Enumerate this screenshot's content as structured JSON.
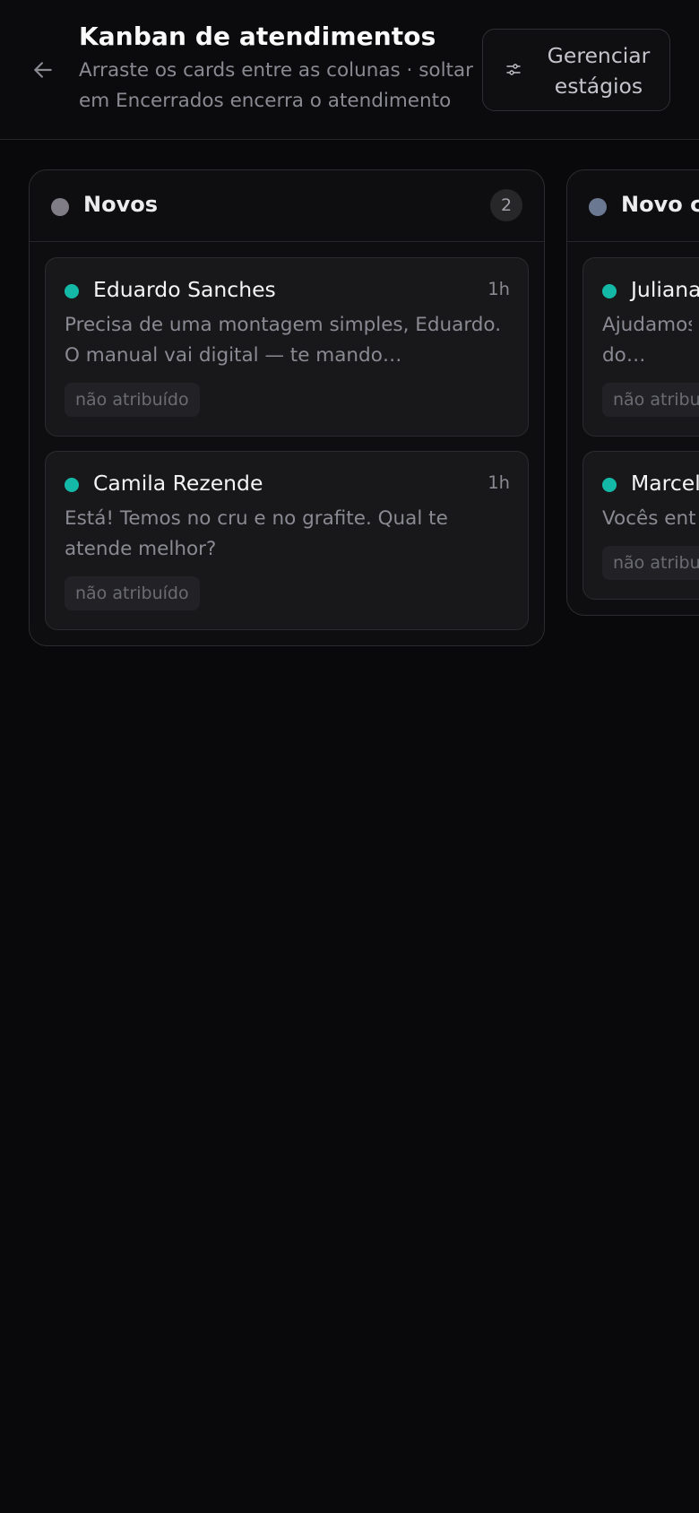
{
  "header": {
    "title": "Kanban de atendimentos",
    "subtitle": "Arraste os cards entre as colunas · soltar em Encerrados encerra o atendimento",
    "manage_button": "Gerenciar estágios"
  },
  "columns": [
    {
      "title": "Novos",
      "count": "2",
      "dot_color": "#807d87",
      "cards": [
        {
          "name": "Eduardo Sanches",
          "time": "1h",
          "preview": "Precisa de uma montagem simples, Eduardo. O manual vai digital — te mando…",
          "assignee": "não atribuído"
        },
        {
          "name": "Camila Rezende",
          "time": "1h",
          "preview": "Está! Temos no cru e no grafite. Qual te atende melhor?",
          "assignee": "não atribuído"
        }
      ]
    },
    {
      "title": "Novo c",
      "count": "",
      "dot_color": "#6b7891",
      "cards": [
        {
          "name": "Juliana",
          "time": "",
          "preview": "Ajudamos do quarto",
          "assignee": "não atribu"
        },
        {
          "name": "Marcel",
          "time": "",
          "preview": "Vocês ent",
          "assignee": "não atribu"
        }
      ]
    }
  ],
  "colors": {
    "background": "#09090b",
    "online_dot": "#14b8a6"
  }
}
